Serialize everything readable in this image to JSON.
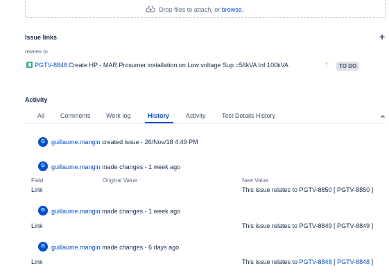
{
  "dropzone": {
    "text": "Drop files to attach, or",
    "link": "browse.",
    "icon": "upload-cloud-icon"
  },
  "issue_links": {
    "title": "Issue links",
    "add_icon": "+",
    "relation": "relates to",
    "item": {
      "key": "PGTV-8848",
      "summary": "Create HP - MAR Prosumer installation on Low voltage Sup =56kVA Inf 100kVA",
      "priority_icon": "↑",
      "status": "TO DO"
    }
  },
  "activity": {
    "title": "Activity",
    "tabs": [
      "All",
      "Comments",
      "Work log",
      "History",
      "Activity",
      "Test Details History"
    ],
    "active_tab": "History",
    "entries": [
      {
        "avatar": "G",
        "user": "guillaume.mangin",
        "action": "created issue - 26/Nov/18 4:49 PM"
      },
      {
        "avatar": "G",
        "user": "guillaume.mangin",
        "action": "made changes - 1 week ago",
        "headers": {
          "field": "Field",
          "original": "Original Value",
          "new": "New Value"
        },
        "field": "Link",
        "new_value": "This issue relates to PGTV-8850 [ PGTV-8850 ]"
      },
      {
        "avatar": "G",
        "user": "guillaume.mangin",
        "action": "made changes - 1 week ago",
        "field": "Link",
        "new_value": "This issue relates to PGTV-8849 [ PGTV-8849 ]"
      },
      {
        "avatar": "G",
        "user": "guillaume.mangin",
        "action": "made changes - 6 days ago",
        "field": "Link",
        "new_prefix": "This issue relates to ",
        "new_link": "PGTV-8848",
        "new_mid": " [ ",
        "new_link2": "PGTV-8848",
        "new_suffix": " ]"
      }
    ]
  }
}
